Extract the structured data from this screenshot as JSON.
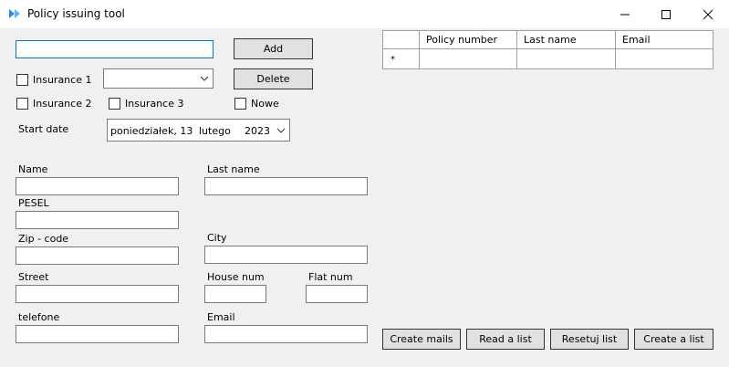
{
  "window": {
    "title": "Policy issuing tool",
    "app_icon": "blue-arrows-icon"
  },
  "toolbar": {
    "add_label": "Add",
    "delete_label": "Delete"
  },
  "checkboxes": {
    "insurance1": "Insurance 1",
    "insurance2": "Insurance 2",
    "insurance3": "Insurance 3",
    "nowe": "Nowe"
  },
  "start_date": {
    "label": "Start date",
    "day_name": "poniedziałek, 13",
    "month": "lutego",
    "year": "2023"
  },
  "form": {
    "name_label": "Name",
    "last_name_label": "Last name",
    "pesel_label": "PESEL",
    "zip_label": "Zip - code",
    "city_label": "City",
    "street_label": "Street",
    "house_num_label": "House num",
    "flat_num_label": "Flat num",
    "telefone_label": "telefone",
    "email_label": "Email"
  },
  "grid": {
    "columns": [
      "Policy number",
      "Last name",
      "Email"
    ],
    "new_row_marker": "*"
  },
  "actions": {
    "create_mails": "Create mails",
    "read_list": "Read a list",
    "reset_list": "Resetuj list",
    "create_list": "Create a list"
  }
}
